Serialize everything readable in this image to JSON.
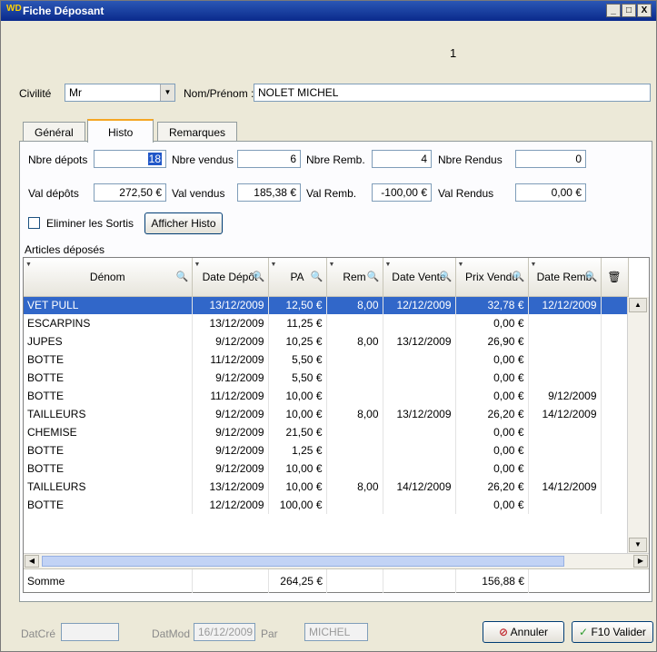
{
  "window": {
    "logo": "WD",
    "title": "Fiche Déposant",
    "minimize": "_",
    "maximize": "□",
    "close": "X"
  },
  "counter": "1",
  "civilite": {
    "label": "Civilité",
    "value": "Mr"
  },
  "nom": {
    "label": "Nom/Prénom :",
    "value": "NOLET MICHEL"
  },
  "tabs": [
    {
      "label": "Général"
    },
    {
      "label": "Histo"
    },
    {
      "label": "Remarques"
    }
  ],
  "stats": {
    "nbre_depots_label": "Nbre dépots",
    "nbre_depots_value": "18",
    "nbre_vendus_label": "Nbre vendus",
    "nbre_vendus_value": "6",
    "nbre_remb_label": "Nbre Remb.",
    "nbre_remb_value": "4",
    "nbre_rendus_label": "Nbre Rendus",
    "nbre_rendus_value": "0",
    "val_depots_label": "Val dépôts",
    "val_depots_value": "272,50 €",
    "val_vendus_label": "Val vendus",
    "val_vendus_value": "185,38 €",
    "val_remb_label": "Val Remb.",
    "val_remb_value": "-100,00 €",
    "val_rendus_label": "Val Rendus",
    "val_rendus_value": "0,00 €"
  },
  "eliminer_label": "Eliminer les Sortis",
  "afficher_histo": "Afficher Histo",
  "articles_label": "Articles déposés",
  "columns": [
    "Dénom",
    "Date Dépôt",
    "PA",
    "Rem",
    "Date Vente",
    "Prix Vendu",
    "Date Remb"
  ],
  "rows": [
    [
      "VET PULL",
      "13/12/2009",
      "12,50 €",
      "8,00",
      "12/12/2009",
      "32,78 €",
      "12/12/2009"
    ],
    [
      "ESCARPINS",
      "13/12/2009",
      "11,25 €",
      "",
      "",
      "0,00 €",
      ""
    ],
    [
      "JUPES",
      "9/12/2009",
      "10,25 €",
      "8,00",
      "13/12/2009",
      "26,90 €",
      ""
    ],
    [
      "BOTTE",
      "11/12/2009",
      "5,50 €",
      "",
      "",
      "0,00 €",
      ""
    ],
    [
      "BOTTE",
      "9/12/2009",
      "5,50 €",
      "",
      "",
      "0,00 €",
      ""
    ],
    [
      "BOTTE",
      "11/12/2009",
      "10,00 €",
      "",
      "",
      "0,00 €",
      "9/12/2009"
    ],
    [
      "TAILLEURS",
      "9/12/2009",
      "10,00 €",
      "8,00",
      "13/12/2009",
      "26,20 €",
      "14/12/2009"
    ],
    [
      "CHEMISE",
      "9/12/2009",
      "21,50 €",
      "",
      "",
      "0,00 €",
      ""
    ],
    [
      "BOTTE",
      "9/12/2009",
      "1,25 €",
      "",
      "",
      "0,00 €",
      ""
    ],
    [
      "BOTTE",
      "9/12/2009",
      "10,00 €",
      "",
      "",
      "0,00 €",
      ""
    ],
    [
      "TAILLEURS",
      "13/12/2009",
      "10,00 €",
      "8,00",
      "14/12/2009",
      "26,20 €",
      "14/12/2009"
    ],
    [
      "BOTTE",
      "12/12/2009",
      "100,00 €",
      "",
      "",
      "0,00 €",
      ""
    ]
  ],
  "somme": {
    "label": "Somme",
    "pa": "264,25 €",
    "prix_vendu": "156,88 €"
  },
  "footer": {
    "datcre_label": "DatCré",
    "datcre_value": "",
    "datmod_label": "DatMod",
    "datmod_value": "16/12/2009",
    "par_label": "Par",
    "par_value": "MICHEL",
    "annuler": "Annuler",
    "valider": "F10 Valider"
  },
  "colors": {
    "title_bar": "#0a2a8c",
    "selection": "#3167c9",
    "tab_accent": "#f5a623"
  }
}
